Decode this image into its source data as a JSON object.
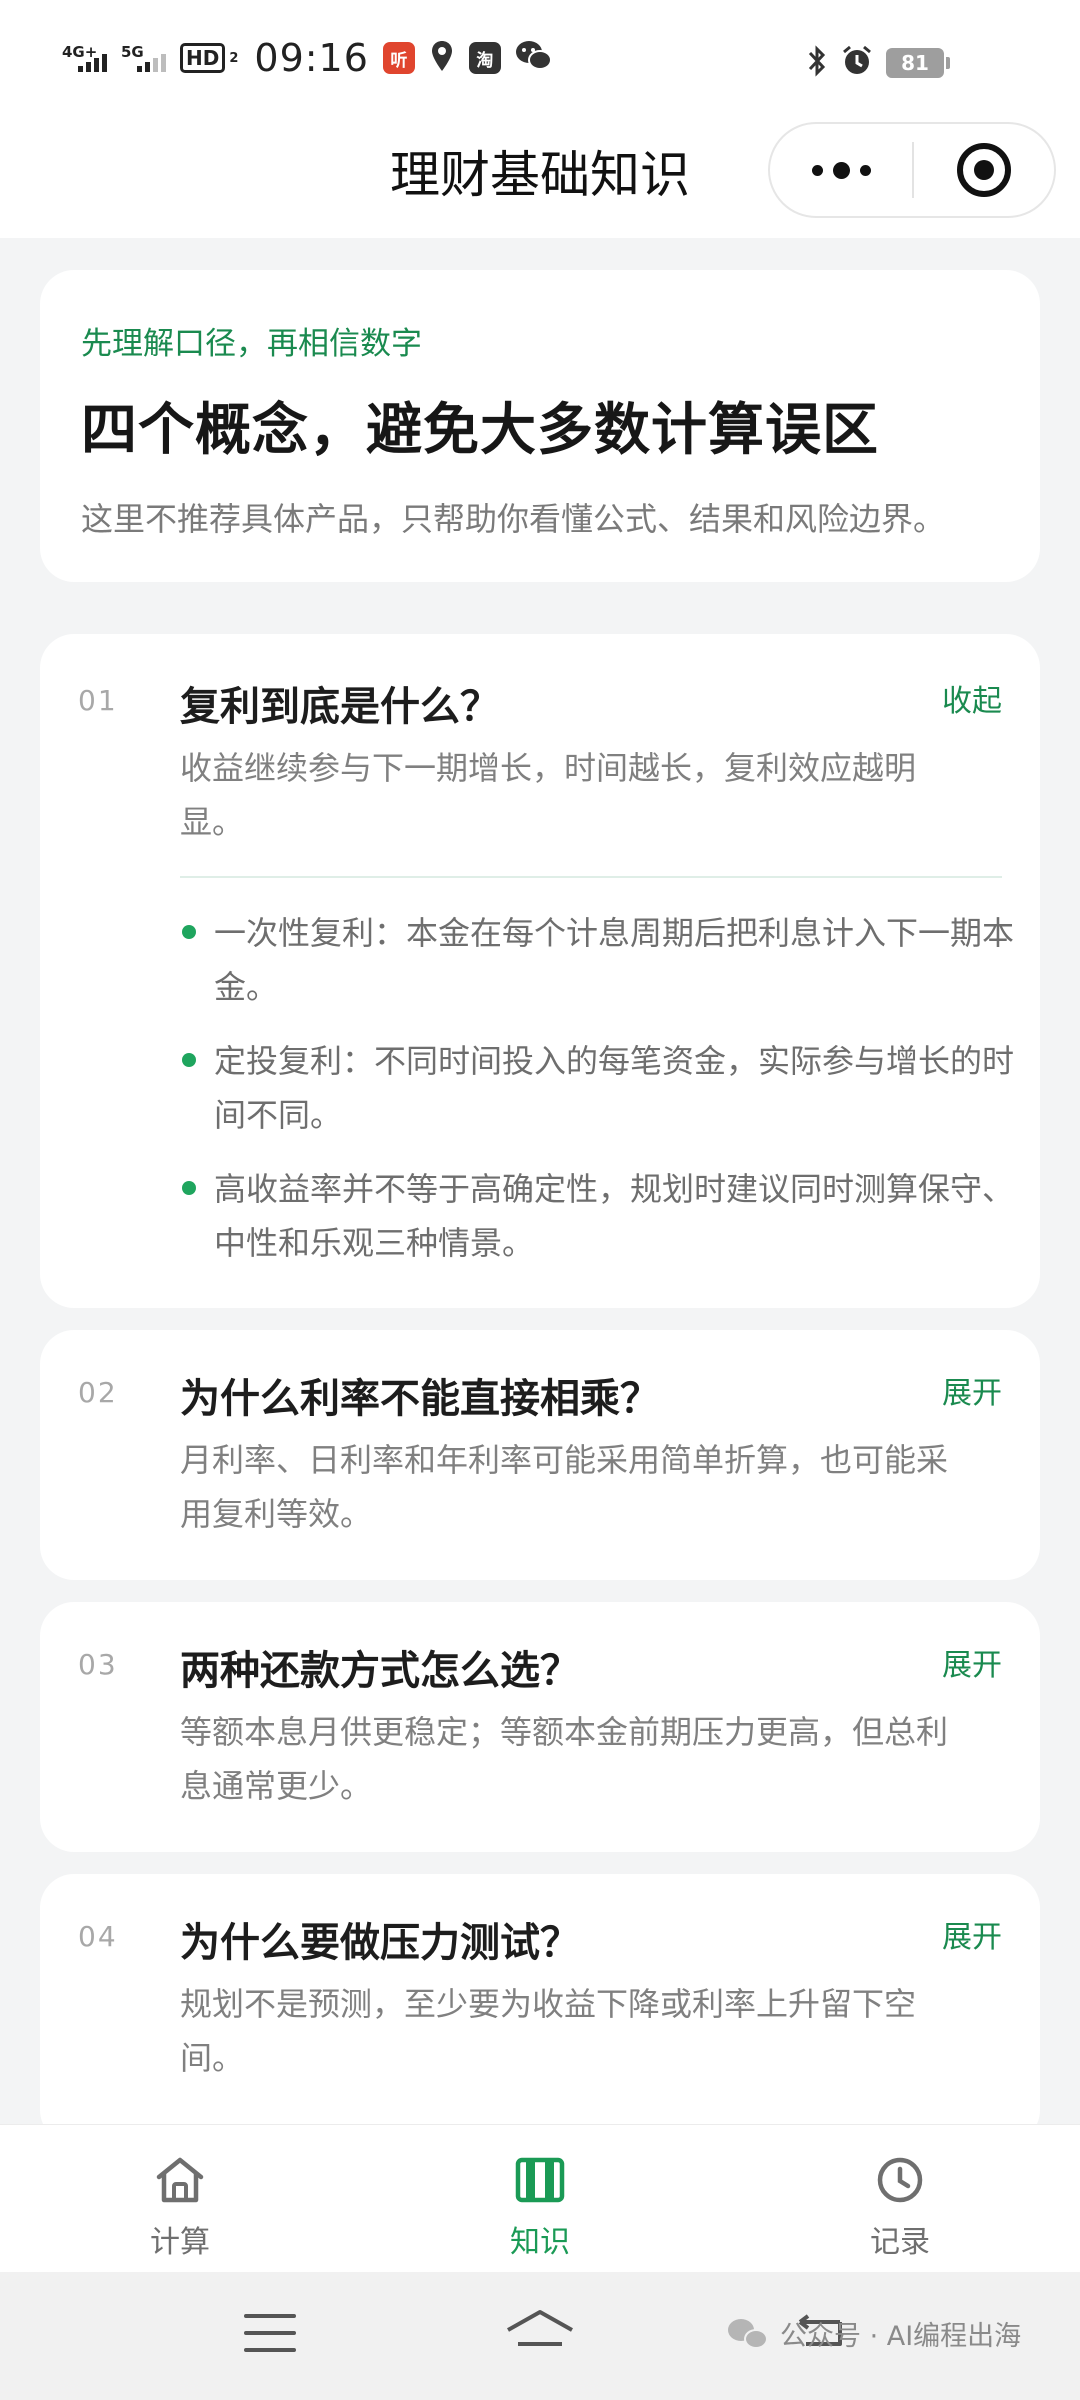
{
  "status_bar": {
    "net1": "4G+",
    "net2": "5G",
    "hd": "HD",
    "hd_sub": "2",
    "time": "09:16",
    "notif_1": "听",
    "notif_3": "淘",
    "battery": "81"
  },
  "nav": {
    "title": "理财基础知识"
  },
  "hero": {
    "eyebrow": "先理解口径，再相信数字",
    "headline": "四个概念，避免大多数计算误区",
    "desc": "这里不推荐具体产品，只帮助你看懂公式、结果和风险边界。"
  },
  "faq": [
    {
      "num": "01",
      "question": "复利到底是什么？",
      "toggle": "收起",
      "answer": "收益继续参与下一期增长，时间越长，复利效应越明显。",
      "bullets": [
        "一次性复利：本金在每个计息周期后把利息计入下一期本金。",
        "定投复利：不同时间投入的每笔资金，实际参与增长的时间不同。",
        "高收益率并不等于高确定性，规划时建议同时测算保守、中性和乐观三种情景。"
      ]
    },
    {
      "num": "02",
      "question": "为什么利率不能直接相乘？",
      "toggle": "展开",
      "answer": "月利率、日利率和年利率可能采用简单折算，也可能采用复利等效。"
    },
    {
      "num": "03",
      "question": "两种还款方式怎么选？",
      "toggle": "展开",
      "answer": "等额本息月供更稳定；等额本金前期压力更高，但总利息通常更少。"
    },
    {
      "num": "04",
      "question": "为什么要做压力测试？",
      "toggle": "展开",
      "answer": "规划不是预测，至少要为收益下降或利率上升留下空间。"
    }
  ],
  "tabs": [
    {
      "label": "计算",
      "icon": "home-icon"
    },
    {
      "label": "知识",
      "icon": "book-icon",
      "active": true
    },
    {
      "label": "记录",
      "icon": "clock-icon"
    }
  ],
  "watermark": "公众号 · AI编程出海",
  "colors": {
    "accent": "#1a8a4f",
    "tab_active": "#1a9a55",
    "bullet": "#1fa55e"
  }
}
